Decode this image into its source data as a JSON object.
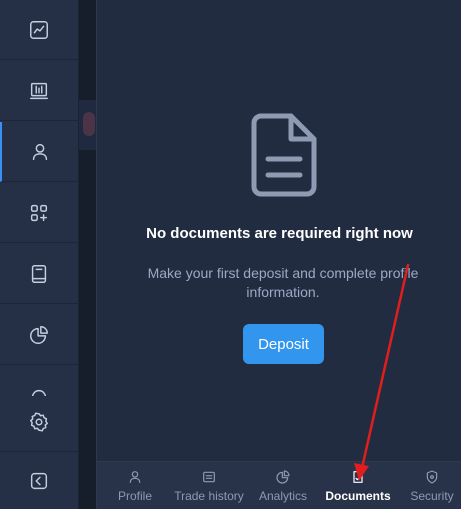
{
  "sidebar": {
    "items": [
      {
        "icon": "chart-line-icon"
      },
      {
        "icon": "market-board-icon"
      },
      {
        "icon": "user-icon"
      },
      {
        "icon": "apps-add-icon"
      },
      {
        "icon": "book-icon"
      },
      {
        "icon": "pie-chart-icon"
      },
      {
        "icon": "headset-icon"
      },
      {
        "icon": "gear-icon"
      },
      {
        "icon": "collapse-icon"
      }
    ],
    "active_index": 2
  },
  "empty_state": {
    "title": "No documents are required right now",
    "subtitle": "Make your first deposit and complete profile information.",
    "icon": "document-icon"
  },
  "deposit_label": "Deposit",
  "tabs": [
    {
      "label": "Profile",
      "icon": "user-icon"
    },
    {
      "label": "Trade history",
      "icon": "history-icon"
    },
    {
      "label": "Analytics",
      "icon": "analytics-icon"
    },
    {
      "label": "Documents",
      "icon": "documents-icon"
    },
    {
      "label": "Security",
      "icon": "shield-icon"
    }
  ],
  "active_tab": "Documents",
  "colors": {
    "accent": "#3296ef",
    "annotation": "#e11d1d",
    "panel": "#222c41",
    "sidebar": "#252f45"
  }
}
